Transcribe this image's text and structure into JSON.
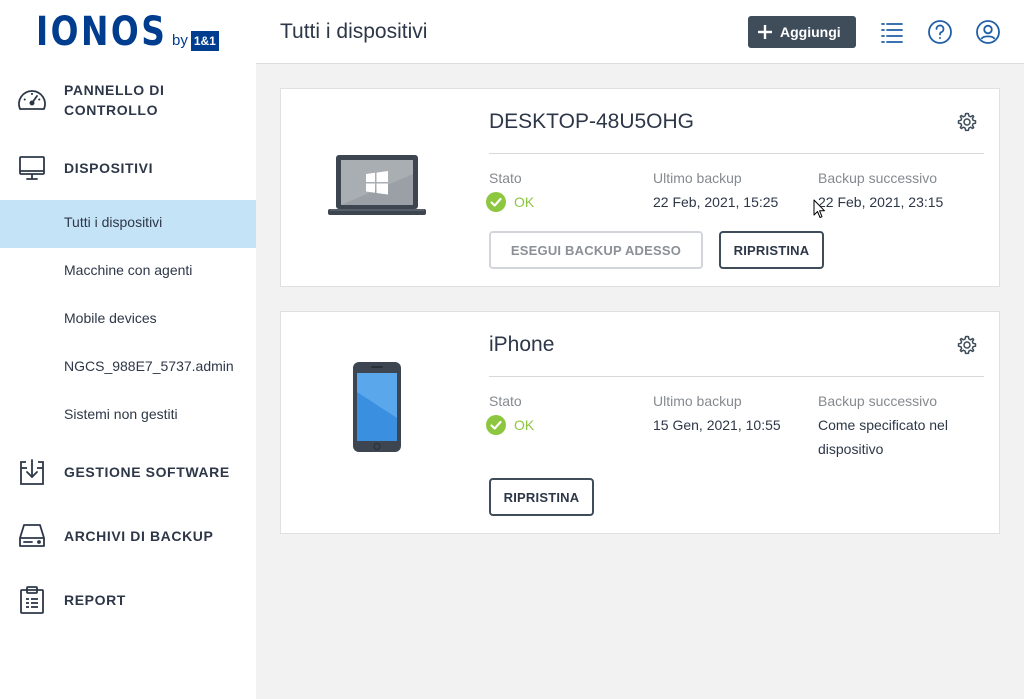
{
  "brand": {
    "name": "IONOS",
    "by": "by",
    "partner": "1&1"
  },
  "sidebar": {
    "items": [
      {
        "label": "PANNELLO DI CONTROLLO",
        "line1": "PANNELLO DI",
        "line2": "CONTROLLO",
        "icon": "speedometer-icon"
      },
      {
        "label": "DISPOSITIVI",
        "icon": "monitor-icon"
      },
      {
        "label": "GESTIONE SOFTWARE",
        "icon": "software-install-icon"
      },
      {
        "label": "ARCHIVI DI BACKUP",
        "icon": "hard-drive-icon"
      },
      {
        "label": "REPORT",
        "icon": "clipboard-icon"
      }
    ],
    "sub_items": [
      {
        "label": "Tutti i dispositivi",
        "active": true
      },
      {
        "label": "Macchine con agenti"
      },
      {
        "label": "Mobile devices"
      },
      {
        "label": "NGCS_988E7_5737.admin"
      },
      {
        "label": "Sistemi non gestiti"
      }
    ]
  },
  "header": {
    "title": "Tutti i dispositivi",
    "add_label": "Aggiungi"
  },
  "devices": [
    {
      "name": "DESKTOP-48U5OHG",
      "type": "laptop",
      "status_label": "Stato",
      "status": "OK",
      "last_backup_label": "Ultimo backup",
      "last_backup": "22 Feb, 2021, 15:25",
      "next_backup_label": "Backup successivo",
      "next_backup": "22 Feb, 2021, 23:15",
      "backup_now_label": "ESEGUI BACKUP ADESSO",
      "restore_label": "RIPRISTINA"
    },
    {
      "name": "iPhone",
      "type": "phone",
      "status_label": "Stato",
      "status": "OK",
      "last_backup_label": "Ultimo backup",
      "last_backup": "15 Gen, 2021, 10:55",
      "next_backup_label": "Backup successivo",
      "next_backup_line1": "Come specificato nel",
      "next_backup_line2": "dispositivo",
      "restore_label": "RIPRISTINA"
    }
  ],
  "colors": {
    "brand": "#003d8f",
    "ok": "#8dc63f",
    "active_bg": "#c5e3f7",
    "button_dark": "#3f4c5a"
  }
}
